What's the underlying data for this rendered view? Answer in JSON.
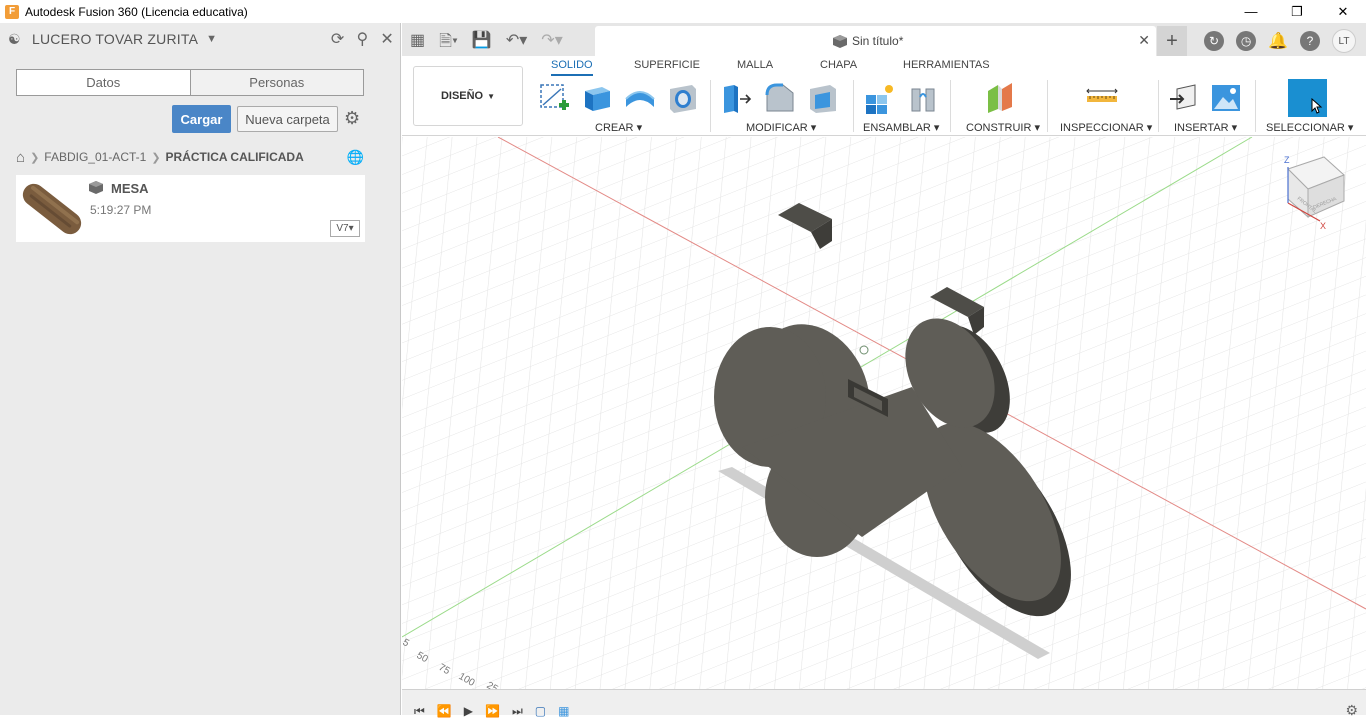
{
  "window": {
    "title": "Autodesk Fusion 360 (Licencia educativa)",
    "app_icon": "F"
  },
  "datapanel": {
    "user": "LUCERO TOVAR ZURITA",
    "tabs": [
      "Datos",
      "Personas"
    ],
    "upload_label": "Cargar",
    "new_folder_label": "Nueva carpeta",
    "breadcrumb": {
      "project": "FABDIG_01-ACT-1",
      "folder": "PRÁCTICA CALIFICADA"
    },
    "files": [
      {
        "name": "MESA",
        "time": "5:19:27 PM",
        "version": "V7"
      }
    ]
  },
  "tabbar": {
    "doc_title": "Sin título*",
    "user_initials": "LT"
  },
  "toolbar": {
    "workspace": "DISEÑO",
    "tabs": [
      "SOLIDO",
      "SUPERFICIE",
      "MALLA",
      "CHAPA",
      "HERRAMIENTAS"
    ],
    "groups": {
      "crear": "CREAR",
      "modificar": "MODIFICAR",
      "ensamblar": "ENSAMBLAR",
      "construir": "CONSTRUIR",
      "inspeccionar": "INSPECCIONAR",
      "insertar": "INSERTAR",
      "seleccionar": "SELECCIONAR"
    }
  },
  "viewport": {
    "viewcube": {
      "axis_z": "Z",
      "axis_x": "X",
      "faces": [
        "FRONTAL",
        "DERECHA"
      ]
    },
    "ruler": [
      "5",
      "50",
      "75",
      "100",
      "25"
    ]
  },
  "colors": {
    "accent": "#1c6fb5",
    "upload_button": "#4a86c7",
    "select_button": "#1a8fd1",
    "model": "#5f5d57"
  }
}
